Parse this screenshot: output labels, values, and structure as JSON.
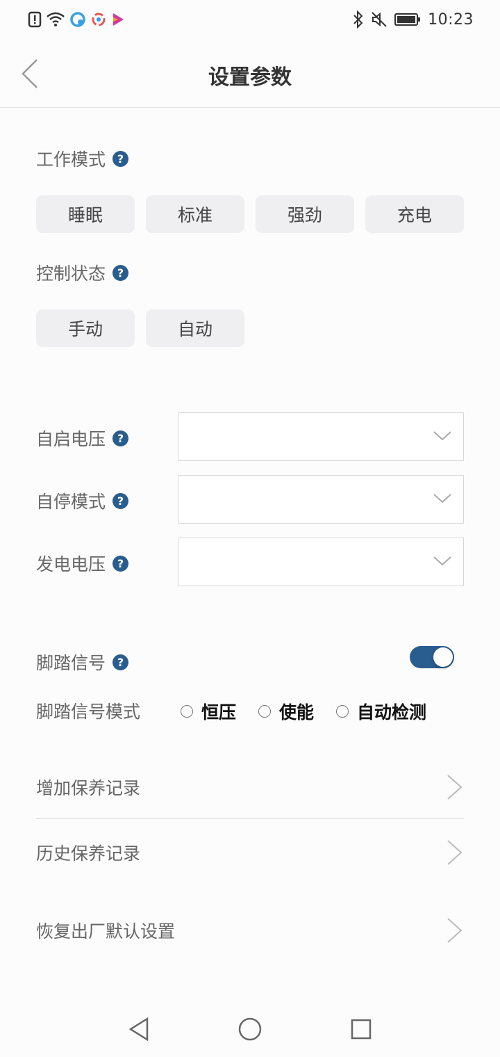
{
  "status_bar": {
    "time": "10:23",
    "left_icons": [
      "alert-icon",
      "wifi-icon",
      "app-icon-cloud",
      "app-icon-ring",
      "app-icon-play"
    ],
    "right_icons": [
      "bluetooth-icon",
      "mute-icon",
      "battery-icon"
    ]
  },
  "header": {
    "title": "设置参数"
  },
  "work_mode": {
    "label": "工作模式",
    "options": [
      "睡眠",
      "标准",
      "强劲",
      "充电"
    ]
  },
  "control_state": {
    "label": "控制状态",
    "options": [
      "手动",
      "自动"
    ]
  },
  "selects": {
    "auto_start_voltage": {
      "label": "自启电压",
      "value": ""
    },
    "auto_stop_mode": {
      "label": "自停模式",
      "value": ""
    },
    "generate_voltage": {
      "label": "发电电压",
      "value": ""
    }
  },
  "pedal_signal": {
    "label": "脚踏信号",
    "enabled": true
  },
  "pedal_mode": {
    "label": "脚踏信号模式",
    "options": [
      "恒压",
      "使能",
      "自动检测"
    ]
  },
  "menu": {
    "add_maintenance": "增加保养记录",
    "history_maintenance": "历史保养记录",
    "factory_reset": "恢复出厂默认设置"
  },
  "colors": {
    "accent": "#2a5d8f",
    "chip_bg": "#efeff1"
  }
}
